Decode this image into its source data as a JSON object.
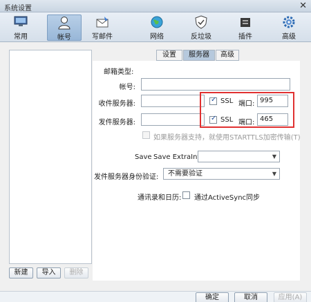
{
  "window": {
    "title": "系统设置",
    "close_glyph": "✕"
  },
  "toolbar": {
    "items": [
      {
        "label": "常用",
        "icon": "monitor-icon"
      },
      {
        "label": "帐号",
        "icon": "person-icon"
      },
      {
        "label": "写邮件",
        "icon": "compose-icon"
      },
      {
        "label": "网络",
        "icon": "globe-icon"
      },
      {
        "label": "反垃圾",
        "icon": "shield-icon"
      },
      {
        "label": "插件",
        "icon": "plugin-icon"
      },
      {
        "label": "高级",
        "icon": "gear-icon"
      }
    ]
  },
  "tabs": [
    {
      "label": "设置"
    },
    {
      "label": "服务器"
    },
    {
      "label": "高级"
    }
  ],
  "form": {
    "mailbox_type_label": "邮箱类型:",
    "account_label": "帐号:",
    "account_value": "",
    "incoming_label": "收件服务器:",
    "incoming_value": "",
    "incoming_ssl_label": "SSL",
    "incoming_port_label": "端口:",
    "incoming_port_value": "995",
    "outgoing_label": "发件服务器:",
    "outgoing_value": "",
    "outgoing_ssl_label": "SSL",
    "outgoing_port_label": "端口:",
    "outgoing_port_value": "465",
    "starttls_label": "如果服务器支持，就使用STARTTLS加密传输(T)",
    "save_label": "Save",
    "save_extrainfo_label": "Save ExtraInfo",
    "save_extrainfo_value": "",
    "auth_label": "发件服务器身份验证:",
    "auth_value": "不需要验证",
    "sync_label": "通讯录和日历:",
    "activesync_label": "通过ActiveSync同步"
  },
  "left_buttons": {
    "new_label": "新建",
    "import_label": "导入",
    "delete_label": "删除"
  },
  "bottom_buttons": {
    "ok_label": "确定",
    "cancel_label": "取消",
    "apply_label": "应用(A)"
  },
  "colors": {
    "highlight": "#e03030",
    "accent": "#1f4e9a"
  }
}
